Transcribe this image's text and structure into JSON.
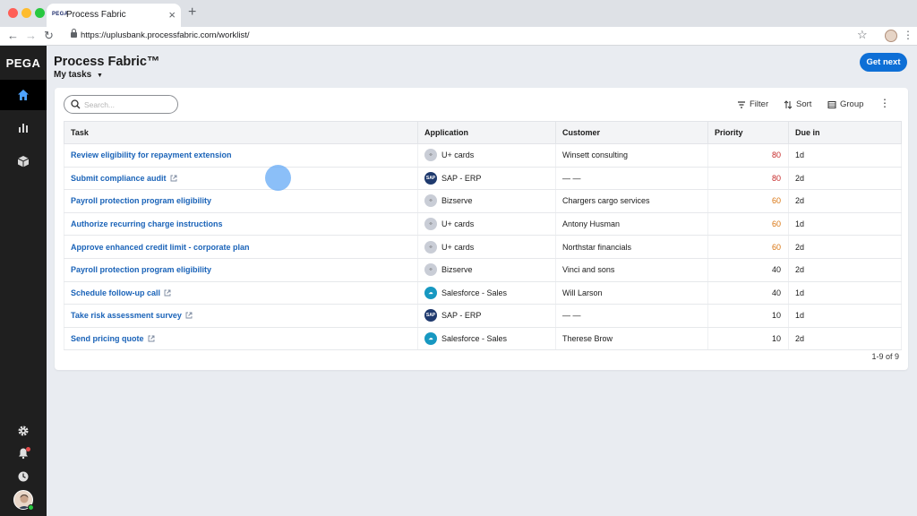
{
  "browser": {
    "tab_title": "Process Fabric",
    "tab_favicon_text": "PEGA",
    "url": "https://uplusbank.processfabric.com/worklist/"
  },
  "nav": {
    "logo": "PEGA",
    "items": [
      "home-icon",
      "chart-bar-icon",
      "cube-icon"
    ],
    "bottom_items": [
      "gear-icon",
      "bell-icon",
      "clock-icon",
      "avatar"
    ]
  },
  "header": {
    "title": "Process Fabric™",
    "subtitle": "My tasks",
    "get_next": "Get next"
  },
  "toolbar": {
    "search_placeholder": "Search...",
    "filter": "Filter",
    "sort": "Sort",
    "group": "Group"
  },
  "table": {
    "columns": [
      "Task",
      "Application",
      "Customer",
      "Priority",
      "Due in"
    ],
    "rows": [
      {
        "task": "Review eligibility for repayment extension",
        "external": false,
        "app": "U+ cards",
        "app_icon": "uplus",
        "customer": "Winsett consulting",
        "priority": "80",
        "priority_color": "#c62828",
        "due": "1d"
      },
      {
        "task": "Submit compliance audit",
        "external": true,
        "app": "SAP - ERP",
        "app_icon": "sap",
        "customer": "— —",
        "priority": "80",
        "priority_color": "#c62828",
        "due": "2d"
      },
      {
        "task": "Payroll protection program eligibility",
        "external": false,
        "app": "Bizserve",
        "app_icon": "bizserve",
        "customer": "Chargers cargo services",
        "priority": "60",
        "priority_color": "#d9730d",
        "due": "2d"
      },
      {
        "task": "Authorize recurring charge instructions",
        "external": false,
        "app": "U+ cards",
        "app_icon": "uplus",
        "customer": "Antony Husman",
        "priority": "60",
        "priority_color": "#d9730d",
        "due": "1d"
      },
      {
        "task": "Approve enhanced credit limit  - corporate plan",
        "external": false,
        "app": "U+ cards",
        "app_icon": "uplus",
        "customer": "Northstar financials",
        "priority": "60",
        "priority_color": "#d9730d",
        "due": "2d"
      },
      {
        "task": "Payroll protection program eligibility",
        "external": false,
        "app": "Bizserve",
        "app_icon": "bizserve",
        "customer": "Vinci and sons",
        "priority": "40",
        "priority_color": "#1b1b1b",
        "due": "2d"
      },
      {
        "task": "Schedule follow-up call",
        "external": true,
        "app": "Salesforce - Sales",
        "app_icon": "salesforce",
        "customer": "Will Larson",
        "priority": "40",
        "priority_color": "#1b1b1b",
        "due": "1d"
      },
      {
        "task": "Take risk assessment survey",
        "external": true,
        "app": "SAP - ERP",
        "app_icon": "sap",
        "customer": "— —",
        "priority": "10",
        "priority_color": "#1b1b1b",
        "due": "1d"
      },
      {
        "task": "Send pricing quote",
        "external": true,
        "app": "Salesforce - Sales",
        "app_icon": "salesforce",
        "customer": "Therese Brow",
        "priority": "10",
        "priority_color": "#1b1b1b",
        "due": "2d"
      }
    ],
    "pagination": "1-9 of 9"
  },
  "colors": {
    "accent": "#0e6fd6",
    "link": "#1a63b8",
    "nav_bg": "#1f1f1f"
  }
}
